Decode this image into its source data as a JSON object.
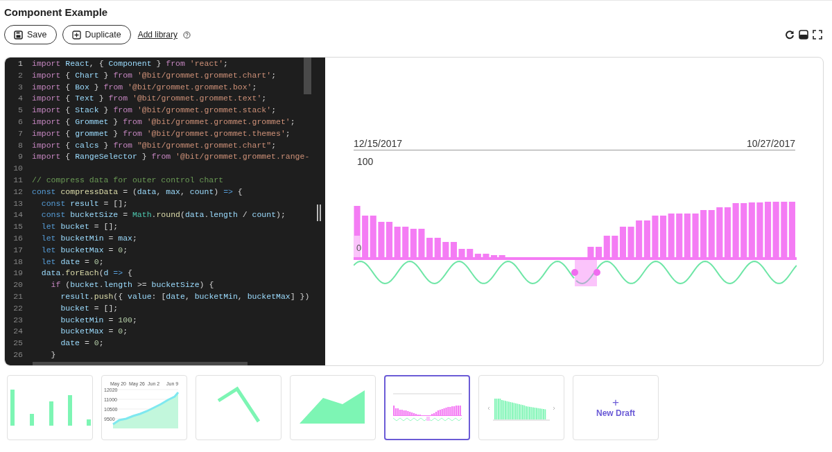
{
  "page": {
    "title": "Component Example"
  },
  "toolbar": {
    "buttons": [
      {
        "kind": "save",
        "label": "Save"
      },
      {
        "kind": "duplicate",
        "label": "Duplicate"
      }
    ],
    "link": "Add library"
  },
  "editor": {
    "lines": [
      {
        "n": "1",
        "tokens": [
          {
            "kind": "keyword",
            "text": "import "
          },
          {
            "kind": "variable",
            "text": "React"
          },
          {
            "kind": "plain",
            "text": ", { "
          },
          {
            "kind": "variable",
            "text": "Component"
          },
          {
            "kind": "plain",
            "text": " } "
          },
          {
            "kind": "keyword",
            "text": "from "
          },
          {
            "kind": "string",
            "text": "'react'"
          },
          {
            "kind": "plain",
            "text": ";"
          }
        ]
      },
      {
        "n": "2",
        "tokens": [
          {
            "kind": "keyword",
            "text": "import"
          },
          {
            "kind": "plain",
            "text": " { "
          },
          {
            "kind": "variable",
            "text": "Chart"
          },
          {
            "kind": "plain",
            "text": " } "
          },
          {
            "kind": "keyword",
            "text": "from "
          },
          {
            "kind": "string",
            "text": "'@bit/grommet.grommet.chart'"
          },
          {
            "kind": "plain",
            "text": ";"
          }
        ]
      },
      {
        "n": "3",
        "tokens": [
          {
            "kind": "keyword",
            "text": "import"
          },
          {
            "kind": "plain",
            "text": " { "
          },
          {
            "kind": "variable",
            "text": "Box"
          },
          {
            "kind": "plain",
            "text": " } "
          },
          {
            "kind": "keyword",
            "text": "from "
          },
          {
            "kind": "string",
            "text": "'@bit/grommet.grommet.box'"
          },
          {
            "kind": "plain",
            "text": ";"
          }
        ]
      },
      {
        "n": "4",
        "tokens": [
          {
            "kind": "keyword",
            "text": "import"
          },
          {
            "kind": "plain",
            "text": " { "
          },
          {
            "kind": "variable",
            "text": "Text"
          },
          {
            "kind": "plain",
            "text": " } "
          },
          {
            "kind": "keyword",
            "text": "from "
          },
          {
            "kind": "string",
            "text": "'@bit/grommet.grommet.text'"
          },
          {
            "kind": "plain",
            "text": ";"
          }
        ]
      },
      {
        "n": "5",
        "tokens": [
          {
            "kind": "keyword",
            "text": "import"
          },
          {
            "kind": "plain",
            "text": " { "
          },
          {
            "kind": "variable",
            "text": "Stack"
          },
          {
            "kind": "plain",
            "text": " } "
          },
          {
            "kind": "keyword",
            "text": "from "
          },
          {
            "kind": "string",
            "text": "'@bit/grommet.grommet.stack'"
          },
          {
            "kind": "plain",
            "text": ";"
          }
        ]
      },
      {
        "n": "6",
        "tokens": [
          {
            "kind": "keyword",
            "text": "import"
          },
          {
            "kind": "plain",
            "text": " { "
          },
          {
            "kind": "variable",
            "text": "Grommet"
          },
          {
            "kind": "plain",
            "text": " } "
          },
          {
            "kind": "keyword",
            "text": "from "
          },
          {
            "kind": "string",
            "text": "'@bit/grommet.grommet.grommet'"
          },
          {
            "kind": "plain",
            "text": ";"
          }
        ]
      },
      {
        "n": "7",
        "tokens": [
          {
            "kind": "keyword",
            "text": "import"
          },
          {
            "kind": "plain",
            "text": " { "
          },
          {
            "kind": "variable",
            "text": "grommet"
          },
          {
            "kind": "plain",
            "text": " } "
          },
          {
            "kind": "keyword",
            "text": "from "
          },
          {
            "kind": "string",
            "text": "'@bit/grommet.grommet.themes'"
          },
          {
            "kind": "plain",
            "text": ";"
          }
        ]
      },
      {
        "n": "8",
        "tokens": [
          {
            "kind": "keyword",
            "text": "import"
          },
          {
            "kind": "plain",
            "text": " { "
          },
          {
            "kind": "variable",
            "text": "calcs"
          },
          {
            "kind": "plain",
            "text": " } "
          },
          {
            "kind": "keyword",
            "text": "from "
          },
          {
            "kind": "string",
            "text": "\"@bit/grommet.grommet.chart\""
          },
          {
            "kind": "plain",
            "text": ";"
          }
        ]
      },
      {
        "n": "9",
        "tokens": [
          {
            "kind": "keyword",
            "text": "import"
          },
          {
            "kind": "plain",
            "text": " { "
          },
          {
            "kind": "variable",
            "text": "RangeSelector"
          },
          {
            "kind": "plain",
            "text": " } "
          },
          {
            "kind": "keyword",
            "text": "from "
          },
          {
            "kind": "string",
            "text": "'@bit/grommet.grommet.range-"
          }
        ]
      },
      {
        "n": "10"
      },
      {
        "n": "11",
        "tokens": [
          {
            "kind": "comment",
            "text": "// compress data for outer control chart"
          }
        ]
      },
      {
        "n": "12",
        "tokens": [
          {
            "kind": "storage",
            "text": "const "
          },
          {
            "kind": "function",
            "text": "compressData"
          },
          {
            "kind": "plain",
            "text": " = ("
          },
          {
            "kind": "variable",
            "text": "data"
          },
          {
            "kind": "plain",
            "text": ", "
          },
          {
            "kind": "variable",
            "text": "max"
          },
          {
            "kind": "plain",
            "text": ", "
          },
          {
            "kind": "variable",
            "text": "count"
          },
          {
            "kind": "plain",
            "text": ") "
          },
          {
            "kind": "storage",
            "text": "=>"
          },
          {
            "kind": "plain",
            "text": " {"
          }
        ]
      },
      {
        "n": "13",
        "tokens": [
          {
            "kind": "storage",
            "text": "  const "
          },
          {
            "kind": "variable",
            "text": "result"
          },
          {
            "kind": "plain",
            "text": " = [];"
          }
        ]
      },
      {
        "n": "14",
        "tokens": [
          {
            "kind": "storage",
            "text": "  const "
          },
          {
            "kind": "variable",
            "text": "bucketSize"
          },
          {
            "kind": "plain",
            "text": " = "
          },
          {
            "kind": "type",
            "text": "Math"
          },
          {
            "kind": "plain",
            "text": "."
          },
          {
            "kind": "function",
            "text": "round"
          },
          {
            "kind": "plain",
            "text": "("
          },
          {
            "kind": "variable",
            "text": "data"
          },
          {
            "kind": "plain",
            "text": "."
          },
          {
            "kind": "variable",
            "text": "length"
          },
          {
            "kind": "plain",
            "text": " / "
          },
          {
            "kind": "variable",
            "text": "count"
          },
          {
            "kind": "plain",
            "text": ");"
          }
        ]
      },
      {
        "n": "15",
        "tokens": [
          {
            "kind": "storage",
            "text": "  let "
          },
          {
            "kind": "variable",
            "text": "bucket"
          },
          {
            "kind": "plain",
            "text": " = [];"
          }
        ]
      },
      {
        "n": "16",
        "tokens": [
          {
            "kind": "storage",
            "text": "  let "
          },
          {
            "kind": "variable",
            "text": "bucketMin"
          },
          {
            "kind": "plain",
            "text": " = "
          },
          {
            "kind": "variable",
            "text": "max"
          },
          {
            "kind": "plain",
            "text": ";"
          }
        ]
      },
      {
        "n": "17",
        "tokens": [
          {
            "kind": "storage",
            "text": "  let "
          },
          {
            "kind": "variable",
            "text": "bucketMax"
          },
          {
            "kind": "plain",
            "text": " = "
          },
          {
            "kind": "number",
            "text": "0"
          },
          {
            "kind": "plain",
            "text": ";"
          }
        ]
      },
      {
        "n": "18",
        "tokens": [
          {
            "kind": "storage",
            "text": "  let "
          },
          {
            "kind": "variable",
            "text": "date"
          },
          {
            "kind": "plain",
            "text": " = "
          },
          {
            "kind": "number",
            "text": "0"
          },
          {
            "kind": "plain",
            "text": ";"
          }
        ]
      },
      {
        "n": "19",
        "tokens": [
          {
            "kind": "variable",
            "text": "  data"
          },
          {
            "kind": "plain",
            "text": "."
          },
          {
            "kind": "function",
            "text": "forEach"
          },
          {
            "kind": "plain",
            "text": "("
          },
          {
            "kind": "variable",
            "text": "d "
          },
          {
            "kind": "storage",
            "text": "=>"
          },
          {
            "kind": "plain",
            "text": " {"
          }
        ]
      },
      {
        "n": "20",
        "tokens": [
          {
            "kind": "keyword",
            "text": "    if"
          },
          {
            "kind": "plain",
            "text": " ("
          },
          {
            "kind": "variable",
            "text": "bucket"
          },
          {
            "kind": "plain",
            "text": "."
          },
          {
            "kind": "variable",
            "text": "length"
          },
          {
            "kind": "plain",
            "text": " >= "
          },
          {
            "kind": "variable",
            "text": "bucketSize"
          },
          {
            "kind": "plain",
            "text": ") {"
          }
        ]
      },
      {
        "n": "21",
        "tokens": [
          {
            "kind": "variable",
            "text": "      result"
          },
          {
            "kind": "plain",
            "text": "."
          },
          {
            "kind": "function",
            "text": "push"
          },
          {
            "kind": "plain",
            "text": "({ "
          },
          {
            "kind": "variable",
            "text": "value"
          },
          {
            "kind": "plain",
            "text": ": ["
          },
          {
            "kind": "variable",
            "text": "date"
          },
          {
            "kind": "plain",
            "text": ", "
          },
          {
            "kind": "variable",
            "text": "bucketMin"
          },
          {
            "kind": "plain",
            "text": ", "
          },
          {
            "kind": "variable",
            "text": "bucketMax"
          },
          {
            "kind": "plain",
            "text": "] })"
          }
        ]
      },
      {
        "n": "22",
        "tokens": [
          {
            "kind": "variable",
            "text": "      bucket"
          },
          {
            "kind": "plain",
            "text": " = [];"
          }
        ]
      },
      {
        "n": "23",
        "tokens": [
          {
            "kind": "variable",
            "text": "      bucketMin"
          },
          {
            "kind": "plain",
            "text": " = "
          },
          {
            "kind": "number",
            "text": "100"
          },
          {
            "kind": "plain",
            "text": ";"
          }
        ]
      },
      {
        "n": "24",
        "tokens": [
          {
            "kind": "variable",
            "text": "      bucketMax"
          },
          {
            "kind": "plain",
            "text": " = "
          },
          {
            "kind": "number",
            "text": "0"
          },
          {
            "kind": "plain",
            "text": ";"
          }
        ]
      },
      {
        "n": "25",
        "tokens": [
          {
            "kind": "variable",
            "text": "      date"
          },
          {
            "kind": "plain",
            "text": " = "
          },
          {
            "kind": "number",
            "text": "0"
          },
          {
            "kind": "plain",
            "text": ";"
          }
        ]
      },
      {
        "n": "26",
        "tokens": [
          {
            "kind": "plain",
            "text": "    }"
          }
        ]
      }
    ]
  },
  "preview": {
    "start_date": "12/15/2017",
    "end_date": "10/27/2017",
    "top_label": "100",
    "bottom_label": "0"
  },
  "drafts": [
    {
      "kind": "bars",
      "selected": false
    },
    {
      "kind": "area-line",
      "selected": false,
      "x_labels": [
        "May 20",
        "May 26",
        "Jun 2",
        "Jun 9"
      ],
      "y_labels": [
        "12020",
        "11000",
        "10500",
        "9500"
      ]
    },
    {
      "kind": "line",
      "selected": false
    },
    {
      "kind": "area",
      "selected": false
    },
    {
      "kind": "range",
      "selected": true
    },
    {
      "kind": "columns",
      "selected": false
    },
    {
      "kind": "new",
      "icon": "+",
      "label": "New Draft"
    }
  ]
}
